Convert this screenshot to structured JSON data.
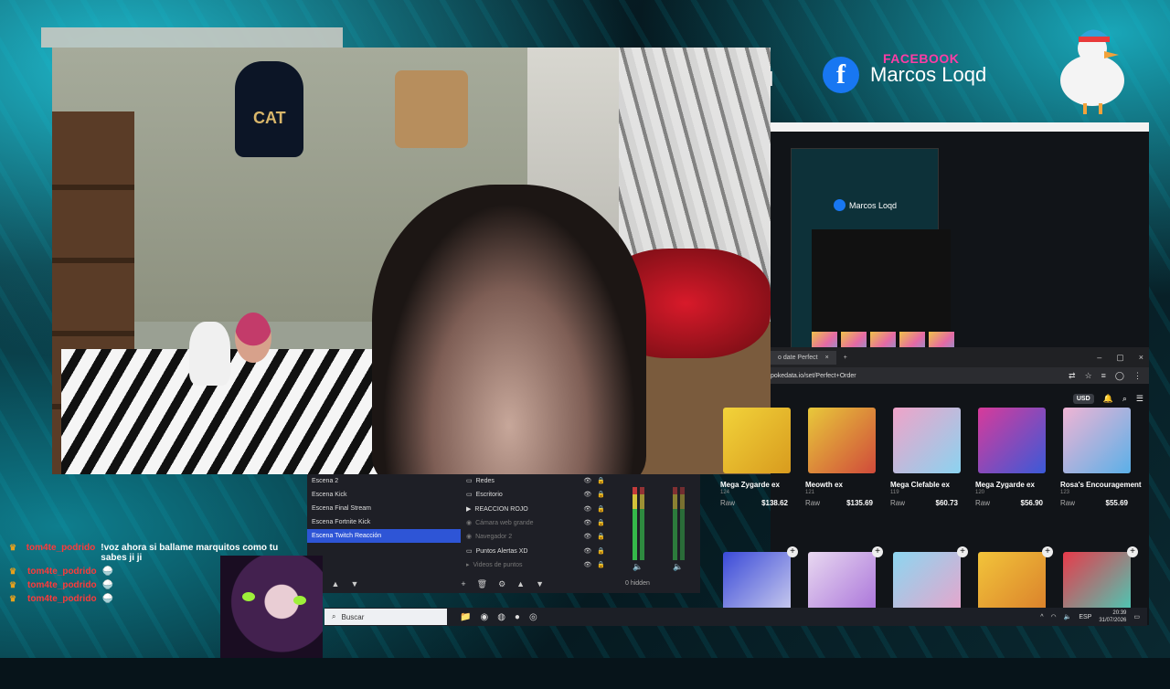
{
  "social": {
    "facebook_label": "FACEBOOK",
    "facebook_name": "Marcos Loqd",
    "partial_name": "d"
  },
  "webcam": {
    "backpack_text": "CAT"
  },
  "browser": {
    "mini_fb_name": "Marcos Loqd",
    "tab_title": "o date Perfect",
    "url": "pokedata.io/set/Perfect+Order",
    "currency": "USD",
    "cards_row1": [
      {
        "name": "Mega Zygarde ex",
        "num": "124",
        "label": "Raw",
        "price": "$138.62",
        "c1": "#f2d33a",
        "c2": "#d89b1e"
      },
      {
        "name": "Meowth ex",
        "num": "121",
        "label": "Raw",
        "price": "$135.69",
        "c1": "#e8c93a",
        "c2": "#d04a3a"
      },
      {
        "name": "Mega Clefable ex",
        "num": "119",
        "label": "Raw",
        "price": "$60.73",
        "c1": "#f0a3c8",
        "c2": "#8bd3f0"
      },
      {
        "name": "Mega Zygarde ex",
        "num": "120",
        "label": "Raw",
        "price": "$56.90",
        "c1": "#d83a9a",
        "c2": "#3a5ad8"
      },
      {
        "name": "Rosa's Encouragement",
        "num": "123",
        "label": "Raw",
        "price": "$55.69",
        "c1": "#f0b4d4",
        "c2": "#5ab0e8"
      }
    ],
    "cards_row2": [
      {
        "c1": "#3a4ad8",
        "c2": "#d8d8f0"
      },
      {
        "c1": "#e8d8f0",
        "c2": "#a46ad8"
      },
      {
        "c1": "#8cd6f0",
        "c2": "#f0a0c8"
      },
      {
        "c1": "#f2c43a",
        "c2": "#d87a2a"
      },
      {
        "c1": "#e83a4a",
        "c2": "#3ad8c0"
      }
    ]
  },
  "obs": {
    "scenes": [
      "Escena 2",
      "Escena Kick",
      "Escena Final Stream",
      "Escena Fortnite Kick",
      "Escena Twitch Reacción"
    ],
    "selected_scene": "Escena Twitch Reacción",
    "sources": [
      {
        "icon": "▭",
        "name": "Redes",
        "dim": false
      },
      {
        "icon": "▭",
        "name": "Escritorio",
        "dim": false
      },
      {
        "icon": "▶",
        "name": "REACCION ROJO",
        "dim": false
      },
      {
        "icon": "◉",
        "name": "Cámara web grande",
        "dim": true
      },
      {
        "icon": "◉",
        "name": "Navegador 2",
        "dim": true
      },
      {
        "icon": "▭",
        "name": "Puntos Alertas XD",
        "dim": false
      },
      {
        "icon": "▸",
        "name": "Videos de puntos",
        "dim": true
      }
    ],
    "hidden": "0 hidden"
  },
  "taskbar": {
    "search_placeholder": "Buscar",
    "lang": "ESP",
    "time": "20:39",
    "date": "31/07/2026"
  },
  "chat": [
    {
      "user": "tom4te_podrido",
      "text": "!voz ahora si ballame marquitos como tu sabes ji ji"
    },
    {
      "user": "tom4te_podrido",
      "text": "🍚"
    },
    {
      "user": "tom4te_podrido",
      "text": "🍚"
    },
    {
      "user": "tom4te_podrido",
      "text": "🍚"
    }
  ],
  "colors": {
    "accent": "#1fb9cc",
    "facebook": "#1877f2",
    "obs_selected": "#2e55d6",
    "chat_user": "#ff3a3a"
  }
}
